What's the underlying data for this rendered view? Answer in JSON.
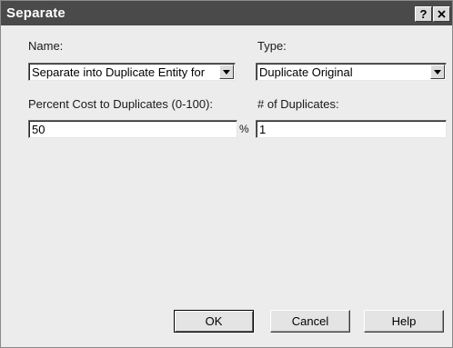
{
  "window": {
    "title": "Separate",
    "help_label": "?",
    "close_label": "✕"
  },
  "form": {
    "name_label": "Name:",
    "name_value": "Separate into Duplicate Entity for",
    "type_label": "Type:",
    "type_value": "Duplicate Original",
    "percent_label": "Percent Cost to Duplicates (0-100):",
    "percent_value": "50",
    "percent_unit": "%",
    "duplicates_label": "# of Duplicates:",
    "duplicates_value": "1"
  },
  "buttons": {
    "ok": "OK",
    "cancel": "Cancel",
    "help": "Help"
  },
  "icons": {
    "dropdown": "chevron-down-icon"
  }
}
